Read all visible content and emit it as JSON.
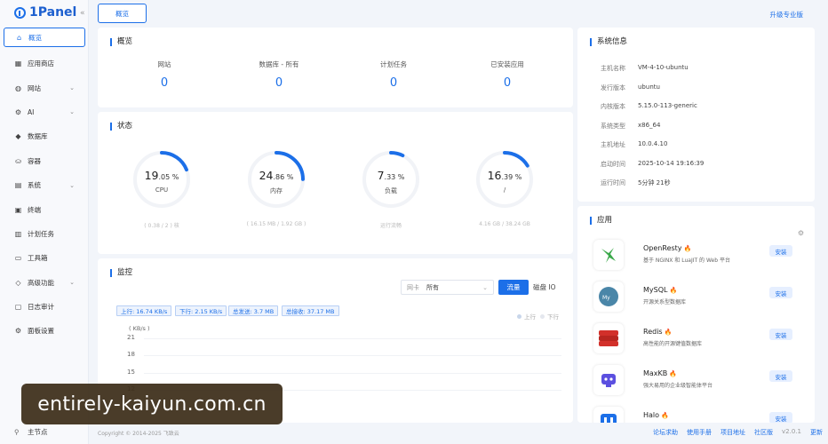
{
  "app": {
    "logo_text": "1Panel",
    "upgrade": "升级专业版"
  },
  "sidebar": {
    "items": [
      {
        "label": "概览",
        "icon": "home-icon",
        "glyph": "⌂",
        "chev": ""
      },
      {
        "label": "应用商店",
        "icon": "grid-icon",
        "glyph": "▦",
        "chev": ""
      },
      {
        "label": "网站",
        "icon": "globe-icon",
        "glyph": "◍",
        "chev": "⌄"
      },
      {
        "label": "AI",
        "icon": "robot-icon",
        "glyph": "⚙",
        "chev": "⌄"
      },
      {
        "label": "数据库",
        "icon": "database-icon",
        "glyph": "◆",
        "chev": ""
      },
      {
        "label": "容器",
        "icon": "container-icon",
        "glyph": "⛀",
        "chev": ""
      },
      {
        "label": "系统",
        "icon": "system-icon",
        "glyph": "▤",
        "chev": "⌄"
      },
      {
        "label": "终端",
        "icon": "terminal-icon",
        "glyph": "▣",
        "chev": ""
      },
      {
        "label": "计划任务",
        "icon": "calendar-icon",
        "glyph": "▥",
        "chev": ""
      },
      {
        "label": "工具箱",
        "icon": "toolbox-icon",
        "glyph": "▭",
        "chev": ""
      },
      {
        "label": "高级功能",
        "icon": "diamond-icon",
        "glyph": "◇",
        "chev": "⌄"
      },
      {
        "label": "日志审计",
        "icon": "log-icon",
        "glyph": "▢",
        "chev": ""
      },
      {
        "label": "面板设置",
        "icon": "settings-icon",
        "glyph": "⚙",
        "chev": ""
      }
    ],
    "node_label": "主节点"
  },
  "tabs": {
    "overview": "概览"
  },
  "overview": {
    "title": "概览",
    "items": [
      {
        "label": "网站",
        "value": "0"
      },
      {
        "label": "数据库 - 所有",
        "value": "0"
      },
      {
        "label": "计划任务",
        "value": "0"
      },
      {
        "label": "已安装应用",
        "value": "0"
      }
    ]
  },
  "status": {
    "title": "状态",
    "gauges": [
      {
        "int": "19",
        "dec": ".05 %",
        "label": "CPU",
        "sub": "( 0.38 / 2 ) 核",
        "percent": 19.05
      },
      {
        "int": "24",
        "dec": ".86 %",
        "label": "内存",
        "sub": "( 16.15 MB / 1.92 GB )",
        "percent": 24.86
      },
      {
        "int": "7",
        "dec": ".33 %",
        "label": "负载",
        "sub": "运行流畅",
        "percent": 7.33
      },
      {
        "int": "16",
        "dec": ".39 %",
        "label": "/",
        "sub": "4.16 GB / 38.24 GB",
        "percent": 16.39
      }
    ]
  },
  "monitor": {
    "title": "监控",
    "nic_label": "网卡",
    "nic_value": "所有",
    "btn_flow": "流量",
    "btn_disk": "磁盘 IO",
    "tags": [
      "上行: 16.74 KB/s",
      "下行: 2.15 KB/s",
      "总发送: 3.7 MB",
      "总接收: 37.17 MB"
    ],
    "legend": [
      "上行",
      "下行"
    ],
    "colors": {
      "up": "#c8d6ea",
      "down": "#e4e7ee"
    },
    "y_unit": "( KB/s )",
    "y_ticks": [
      "21",
      "18",
      "15",
      "12"
    ]
  },
  "sysinfo": {
    "title": "系统信息",
    "rows": [
      {
        "key": "主机名称",
        "value": "VM-4-10-ubuntu"
      },
      {
        "key": "发行版本",
        "value": "ubuntu"
      },
      {
        "key": "内核版本",
        "value": "5.15.0-113-generic"
      },
      {
        "key": "系统类型",
        "value": "x86_64"
      },
      {
        "key": "主机地址",
        "value": "10.0.4.10"
      },
      {
        "key": "启动时间",
        "value": "2025-10-14 19:16:39"
      },
      {
        "key": "运行时间",
        "value": "5分钟 21秒"
      }
    ]
  },
  "apps": {
    "title": "应用",
    "items": [
      {
        "name": "OpenResty",
        "desc": "基于 NGINX 和 LuaJIT 的 Web 平台",
        "btn": "安装",
        "icon": "openresty-icon"
      },
      {
        "name": "MySQL",
        "desc": "开源关系型数据库",
        "btn": "安装",
        "icon": "mysql-icon"
      },
      {
        "name": "Redis",
        "desc": "高性能的开源键值数据库",
        "btn": "安装",
        "icon": "redis-icon"
      },
      {
        "name": "MaxKB",
        "desc": "强大易用的企业级智能体平台",
        "btn": "安装",
        "icon": "maxkb-icon"
      },
      {
        "name": "Halo",
        "desc": "",
        "btn": "安装",
        "icon": "halo-icon"
      }
    ]
  },
  "footer": {
    "copyright": "Copyright © 2014-2025 飞致云",
    "links": [
      "论坛求助",
      "使用手册",
      "项目地址",
      "社区版"
    ],
    "version": "v2.0.1",
    "update": "更新"
  },
  "watermark": "entirely-kaiyun.com.cn",
  "theme": {
    "accent": "#1c6fe8",
    "bg": "#f2f5fa"
  }
}
